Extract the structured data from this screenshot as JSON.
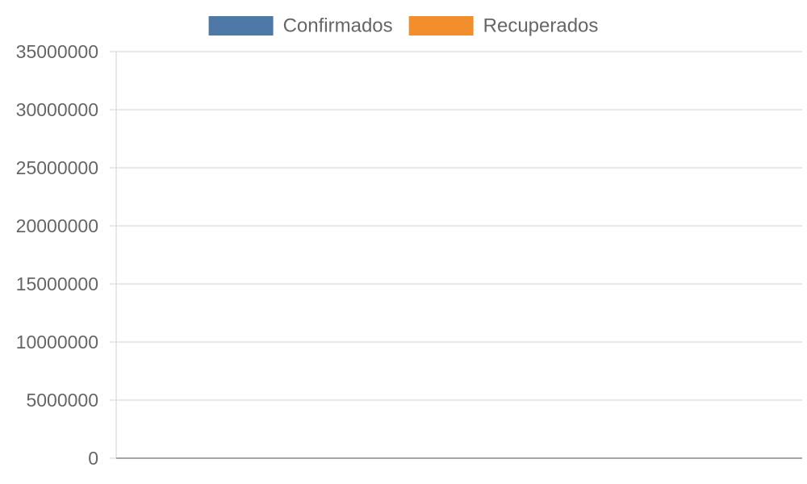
{
  "chart_data": {
    "type": "bar",
    "title": "",
    "xlabel": "",
    "ylabel": "",
    "categories": [],
    "series": [
      {
        "name": "Confirmados",
        "color": "#4e79a7",
        "values": []
      },
      {
        "name": "Recuperados",
        "color": "#f28e2b",
        "values": []
      }
    ],
    "ylim": [
      0,
      35000000
    ],
    "yticks": [
      {
        "value": 35000000,
        "label": "35000000"
      },
      {
        "value": 30000000,
        "label": "30000000"
      },
      {
        "value": 25000000,
        "label": "25000000"
      },
      {
        "value": 20000000,
        "label": "20000000"
      },
      {
        "value": 15000000,
        "label": "15000000"
      },
      {
        "value": 10000000,
        "label": "10000000"
      },
      {
        "value": 5000000,
        "label": "5000000"
      },
      {
        "value": 0,
        "label": "0"
      }
    ],
    "grid": true,
    "legend_position": "top"
  }
}
